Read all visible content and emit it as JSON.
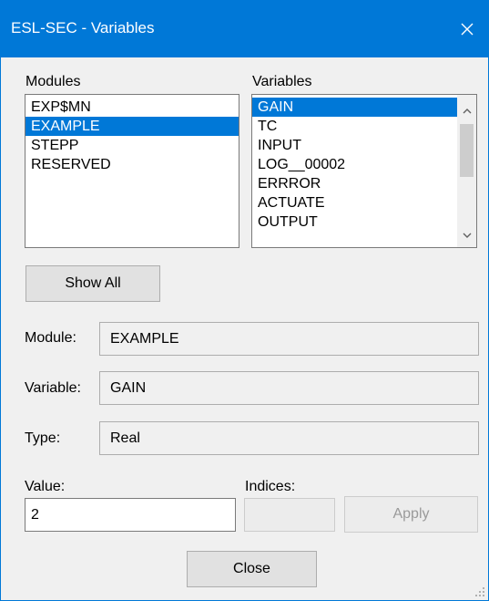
{
  "window": {
    "title": "ESL-SEC - Variables",
    "close_icon": "close-icon"
  },
  "modules": {
    "label": "Modules",
    "items": [
      "EXP$MN",
      "EXAMPLE",
      "STEPP",
      "RESERVED"
    ],
    "selected": "EXAMPLE"
  },
  "variables": {
    "label": "Variables",
    "items": [
      "GAIN",
      "TC",
      "INPUT",
      "LOG__00002",
      "ERRROR",
      "ACTUATE",
      "OUTPUT"
    ],
    "selected": "GAIN"
  },
  "show_all": {
    "label": "Show All"
  },
  "details": {
    "module_label": "Module:",
    "module_value": "EXAMPLE",
    "variable_label": "Variable:",
    "variable_value": "GAIN",
    "type_label": "Type:",
    "type_value": "Real"
  },
  "value": {
    "label": "Value:",
    "current": "2"
  },
  "indices": {
    "label": "Indices:",
    "current": ""
  },
  "apply": {
    "label": "Apply"
  },
  "close": {
    "label": "Close"
  },
  "colors": {
    "accent": "#0078d7",
    "background": "#f0f0f0"
  }
}
